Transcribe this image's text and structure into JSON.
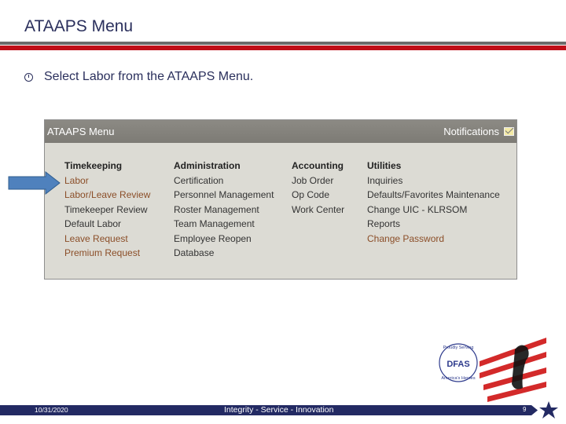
{
  "slide": {
    "title": "ATAAPS Menu",
    "bullet_icon": "clock-bullet-icon",
    "bullet_text": "Select Labor from the ATAAPS Menu."
  },
  "screenshot": {
    "header_title": "ATAAPS Menu",
    "notifications_label": "Notifications",
    "notifications_icon": "mail-icon",
    "columns": [
      {
        "heading": "Timekeeping",
        "items": [
          {
            "label": "Labor",
            "style": "brown"
          },
          {
            "label": "Labor/Leave Review",
            "style": "brown"
          },
          {
            "label": "Timekeeper Review",
            "style": "dark"
          },
          {
            "label": "Default Labor",
            "style": "dark"
          },
          {
            "label": "Leave Request",
            "style": "brown"
          },
          {
            "label": "Premium Request",
            "style": "brown"
          }
        ]
      },
      {
        "heading": "Administration",
        "items": [
          {
            "label": "Certification",
            "style": "dark"
          },
          {
            "label": "Personnel Management",
            "style": "dark"
          },
          {
            "label": "Roster Management",
            "style": "dark"
          },
          {
            "label": "Team Management",
            "style": "dark"
          },
          {
            "label": "Employee Reopen",
            "style": "dark"
          },
          {
            "label": "Database",
            "style": "dark"
          }
        ]
      },
      {
        "heading": "Accounting",
        "items": [
          {
            "label": "Job Order",
            "style": "dark"
          },
          {
            "label": "Op Code",
            "style": "dark"
          },
          {
            "label": "Work Center",
            "style": "dark"
          }
        ]
      },
      {
        "heading": "Utilities",
        "items": [
          {
            "label": "Inquiries",
            "style": "dark"
          },
          {
            "label": "Defaults/Favorites Maintenance",
            "style": "dark"
          },
          {
            "label": "Change UIC - KLRSOM",
            "style": "dark"
          },
          {
            "label": "Reports",
            "style": "dark"
          },
          {
            "label": "Change Password",
            "style": "brown"
          }
        ]
      }
    ]
  },
  "callout": {
    "arrow_icon": "pointer-arrow-icon",
    "color": "#4f81bd"
  },
  "logo": {
    "top_text": "Proudly Serving",
    "center_text": "DFAS",
    "bottom_text": "America's Heroes"
  },
  "footer": {
    "date": "10/31/2020",
    "motto": "Integrity - Service - Innovation",
    "page": "9"
  },
  "colors": {
    "navy": "#232a63",
    "red": "#c00e18",
    "title": "#2a2f5c"
  }
}
